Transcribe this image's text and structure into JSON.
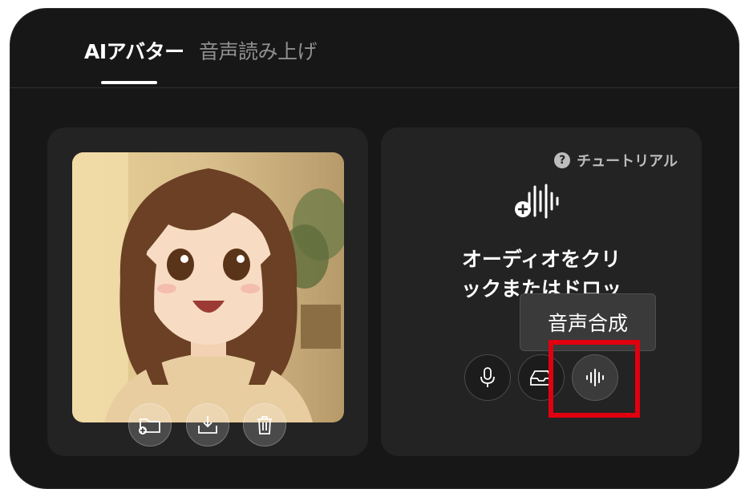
{
  "tabs": [
    {
      "label": "AIアバター",
      "active": true
    },
    {
      "label": "音声読み上げ",
      "active": false
    }
  ],
  "avatar_panel": {
    "image_description_icon": "avatar-portrait",
    "actions": [
      {
        "icon": "folder-add-icon"
      },
      {
        "icon": "download-tray-icon"
      },
      {
        "icon": "trash-icon"
      }
    ]
  },
  "audio_panel": {
    "tutorial_label": "チュートリアル",
    "upload_icon": "audio-add-icon",
    "drop_text_line1": "オーディオをクリ",
    "drop_text_line2": "ックまたはドロッ",
    "actions": [
      {
        "icon": "microphone-icon"
      },
      {
        "icon": "inbox-icon"
      },
      {
        "icon": "waveform-icon"
      }
    ],
    "tooltip": "音声合成"
  },
  "colors": {
    "background": "#171717",
    "card": "#232323",
    "highlight": "#e0000f"
  }
}
